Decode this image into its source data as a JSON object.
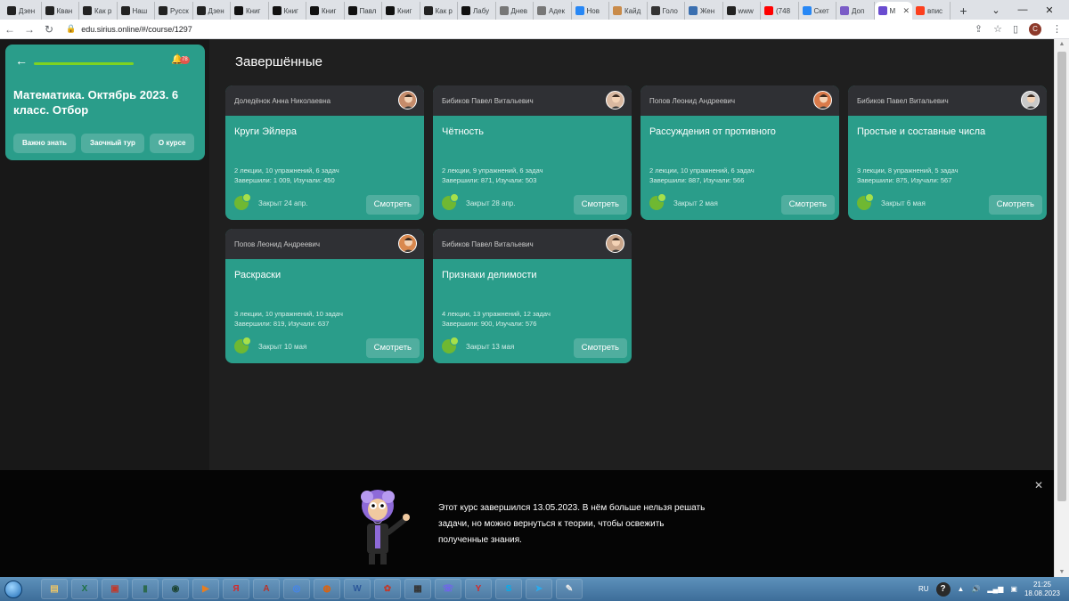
{
  "browser": {
    "tabs": [
      {
        "label": "Дзен",
        "color": "#222222"
      },
      {
        "label": "Кван",
        "color": "#222222"
      },
      {
        "label": "Как р",
        "color": "#222222"
      },
      {
        "label": "Наш",
        "color": "#222222"
      },
      {
        "label": "Русск",
        "color": "#222222"
      },
      {
        "label": "Дзен",
        "color": "#222222"
      },
      {
        "label": "Книг",
        "color": "#111111"
      },
      {
        "label": "Книг",
        "color": "#111111"
      },
      {
        "label": "Книг",
        "color": "#111111"
      },
      {
        "label": "Павл",
        "color": "#111111"
      },
      {
        "label": "Книг",
        "color": "#111111"
      },
      {
        "label": "Как р",
        "color": "#222222"
      },
      {
        "label": "Лабу",
        "color": "#111111"
      },
      {
        "label": "Днев",
        "color": "#777777"
      },
      {
        "label": "Адек",
        "color": "#777777"
      },
      {
        "label": "Нов",
        "color": "#2787f5"
      },
      {
        "label": "Кайд",
        "color": "#c98b4a"
      },
      {
        "label": "Голо",
        "color": "#333333"
      },
      {
        "label": "Жен",
        "color": "#3a6fb0"
      },
      {
        "label": "www",
        "color": "#222222"
      },
      {
        "label": "(748",
        "color": "#ff0000"
      },
      {
        "label": "Скет",
        "color": "#2787f5"
      },
      {
        "label": "Доп",
        "color": "#7a5cc7"
      },
      {
        "label": "М",
        "color": "#6a4cd0",
        "active": true
      },
      {
        "label": "впис",
        "color": "#fc3f1d"
      }
    ],
    "newtab": "+",
    "url": "edu.sirius.online/#/course/1297",
    "profile_initial": "С"
  },
  "course": {
    "title": "Математика. Октябрь 2023. 6 класс. Отбор",
    "notifications": "78",
    "buttons": [
      "Важно знать",
      "Заочный тур",
      "О курсе"
    ]
  },
  "section_title": "Завершённые",
  "cards": [
    {
      "author": "Доледёнок Анна Николаевна",
      "title": "Круги Эйлера",
      "stats1": "2 лекции, 10 упражнений, 6 задач",
      "stats2": "Завершили: 1 009, Изучали: 450",
      "closed": "Закрыт 24 апр.",
      "button": "Смотреть"
    },
    {
      "author": "Бибиков Павел Витальевич",
      "title": "Чётность",
      "stats1": "2 лекции, 9 упражнений, 6 задач",
      "stats2": "Завершили: 871, Изучали: 503",
      "closed": "Закрыт 28 апр.",
      "button": "Смотреть"
    },
    {
      "author": "Попов Леонид Андреевич",
      "title": "Рассуждения от противного",
      "stats1": "2 лекции, 10 упражнений, 6 задач",
      "stats2": "Завершили: 887, Изучали: 566",
      "closed": "Закрыт 2 мая",
      "button": "Смотреть"
    },
    {
      "author": "Бибиков Павел Витальевич",
      "title": "Простые и составные числа",
      "stats1": "3 лекции, 8 упражнений, 5 задач",
      "stats2": "Завершили: 875, Изучали: 567",
      "closed": "Закрыт 6 мая",
      "button": "Смотреть"
    },
    {
      "author": "Попов Леонид Андреевич",
      "title": "Раскраски",
      "stats1": "3 лекции, 10 упражнений, 10 задач",
      "stats2": "Завершили: 819, Изучали: 637",
      "closed": "Закрыт 10 мая",
      "button": "Смотреть"
    },
    {
      "author": "Бибиков Павел Витальевич",
      "title": "Признаки делимости",
      "stats1": "4 лекции, 13 упражнений, 12 задач",
      "stats2": "Завершили: 900, Изучали: 576",
      "closed": "Закрыт 13 мая",
      "button": "Смотреть"
    }
  ],
  "banner": {
    "message": "Этот курс завершился 13.05.2023. В нём больше нельзя решать задачи, но можно вернуться к теории, чтобы освежить полученные знания."
  },
  "taskbar": {
    "apps": [
      "explorer",
      "excel",
      "presentation",
      "app",
      "eye",
      "media",
      "yandex-browser",
      "pdf",
      "chrome",
      "firefox",
      "word",
      "video",
      "app2",
      "viber",
      "yandex",
      "skype",
      "telegram",
      "paint"
    ],
    "app_glyphs": [
      "▤",
      "X",
      "▣",
      "▮",
      "◉",
      "▶",
      "Я",
      "A",
      "◎",
      "◍",
      "W",
      "✿",
      "▦",
      "☏",
      "Y",
      "S",
      "➤",
      "✎"
    ],
    "app_colors": [
      "#e9c46a",
      "#1e7145",
      "#c0392b",
      "#2d6a4f",
      "#1b4332",
      "#e67e22",
      "#d62828",
      "#b8322a",
      "#4285f4",
      "#e66000",
      "#2b579a",
      "#c0392b",
      "#333333",
      "#7360f2",
      "#d62828",
      "#00aff0",
      "#2aabee",
      "#e9e9e9"
    ],
    "lang": "RU",
    "time": "21:25",
    "date": "18.08.2023"
  }
}
